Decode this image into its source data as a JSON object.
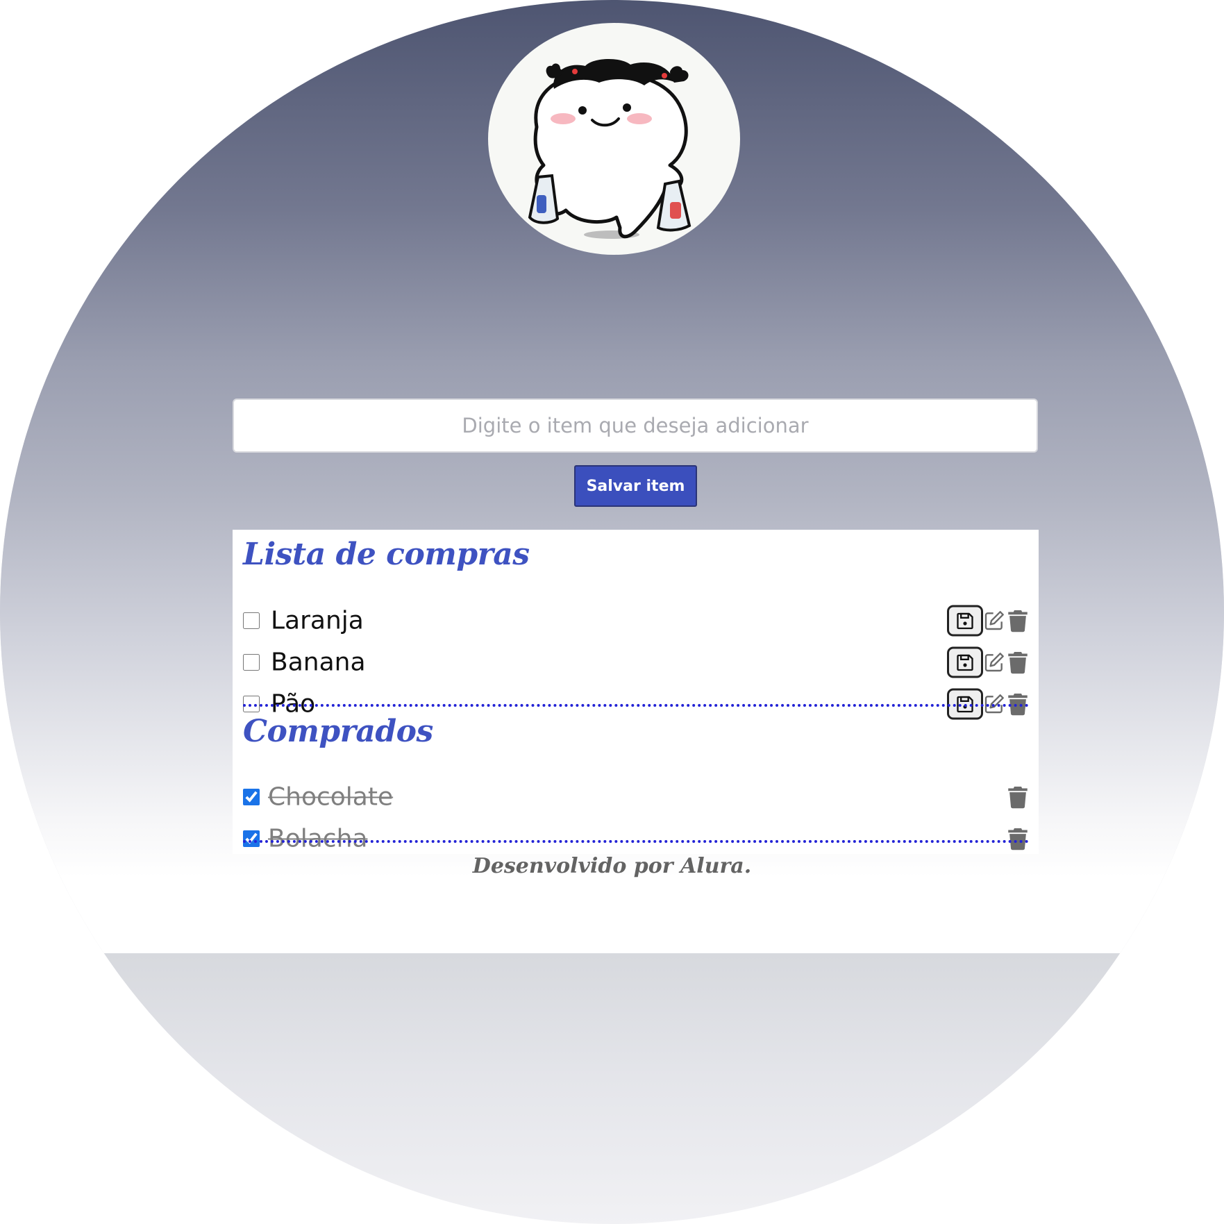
{
  "input": {
    "placeholder": "Digite o item que deseja adicionar"
  },
  "buttons": {
    "save_item_label": "Salvar item"
  },
  "shopping_list": {
    "title": "Lista de compras",
    "items": [
      {
        "label": "Laranja",
        "checked": false
      },
      {
        "label": "Banana",
        "checked": false
      },
      {
        "label": "Pão",
        "checked": false
      }
    ]
  },
  "purchased": {
    "title": "Comprados",
    "items": [
      {
        "label": "Chocolate",
        "checked": true
      },
      {
        "label": "Bolacha",
        "checked": true
      }
    ]
  },
  "footer": {
    "text": "Desenvolvido por Alura."
  },
  "icons": {
    "pending_item_actions": [
      "floppy-disk-icon",
      "pencil-square-icon",
      "trash-icon"
    ],
    "purchased_item_actions": [
      "trash-icon"
    ]
  },
  "colors": {
    "accent_blue": "#3e52c1",
    "button_blue": "#3b4fbd",
    "divider_blue": "#2323d6",
    "checkbox_blue": "#1a73e8",
    "icon_gray": "#6b6b6b"
  }
}
